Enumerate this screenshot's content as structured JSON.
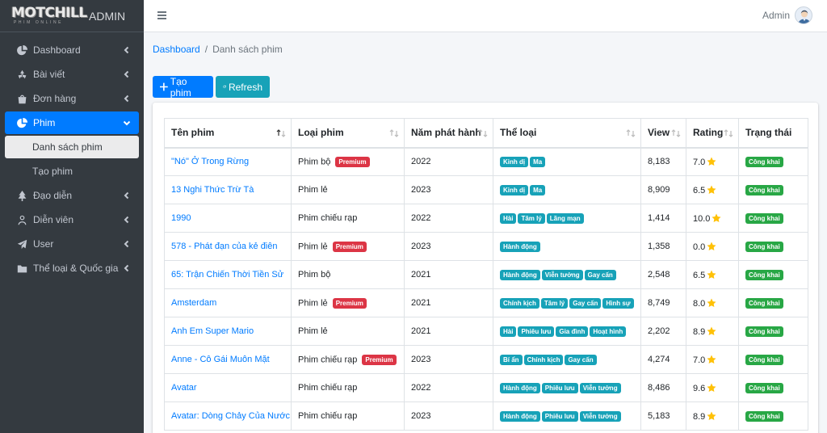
{
  "brand": {
    "logo_text": "MOTCHILL",
    "logo_sub": "PHIM ONLINE",
    "text": "ADMIN"
  },
  "header": {
    "user": "Admin"
  },
  "sidebar": {
    "items": [
      {
        "label": "Dashboard",
        "icon": "pie-chart-icon"
      },
      {
        "label": "Bài viết",
        "icon": "recycle-icon"
      },
      {
        "label": "Đơn hàng",
        "icon": "shopping-bag-icon"
      },
      {
        "label": "Phim",
        "icon": "pie-chart-icon",
        "active": true
      },
      {
        "label": "Đạo diễn",
        "icon": "tree-icon"
      },
      {
        "label": "Diễn viên",
        "icon": "user-icon"
      },
      {
        "label": "User",
        "icon": "paper-plane-icon"
      },
      {
        "label": "Thể loại & Quốc gia",
        "icon": "folder-icon"
      }
    ],
    "sub_items": [
      {
        "label": "Danh sách phim",
        "current": true
      },
      {
        "label": "Tạo phim"
      }
    ]
  },
  "breadcrumb": {
    "home": "Dashboard",
    "current": "Danh sách phim"
  },
  "buttons": {
    "create": "Tạo phim",
    "refresh": "Refresh"
  },
  "table": {
    "columns": [
      "Tên phim",
      "Loại phim",
      "Năm phát hành",
      "Thể loại",
      "View",
      "Rating",
      "Trạng thái"
    ],
    "rows": [
      {
        "title": "\"Nó\" Ở Trong Rừng",
        "type": "Phim bộ",
        "premium": "Premium",
        "year": "2022",
        "genres": [
          "Kinh dị",
          "Ma"
        ],
        "view": "8,183",
        "rating": "7.0",
        "status": "Công khai"
      },
      {
        "title": "13 Nghi Thức Trừ Tà",
        "type": "Phim lẻ",
        "premium": "",
        "year": "2023",
        "genres": [
          "Kinh dị",
          "Ma"
        ],
        "view": "8,909",
        "rating": "6.5",
        "status": "Công khai"
      },
      {
        "title": "1990",
        "type": "Phim chiếu rạp",
        "premium": "",
        "year": "2022",
        "genres": [
          "Hài",
          "Tâm lý",
          "Lãng mạn"
        ],
        "view": "1,414",
        "rating": "10.0",
        "status": "Công khai"
      },
      {
        "title": "578 - Phát đạn của kẻ điên",
        "type": "Phim lẻ",
        "premium": "Premium",
        "year": "2023",
        "genres": [
          "Hành động"
        ],
        "view": "1,358",
        "rating": "0.0",
        "status": "Công khai"
      },
      {
        "title": "65: Trận Chiến Thời Tiền Sử",
        "type": "Phim bộ",
        "premium": "",
        "year": "2021",
        "genres": [
          "Hành động",
          "Viễn tưởng",
          "Gay cấn"
        ],
        "view": "2,548",
        "rating": "6.5",
        "status": "Công khai"
      },
      {
        "title": "Amsterdam",
        "type": "Phim lẻ",
        "premium": "Premium",
        "year": "2021",
        "genres": [
          "Chính kịch",
          "Tâm lý",
          "Gay cấn",
          "Hình sự"
        ],
        "view": "8,749",
        "rating": "8.0",
        "status": "Công khai"
      },
      {
        "title": "Anh Em Super Mario",
        "type": "Phim lẻ",
        "premium": "",
        "year": "2021",
        "genres": [
          "Hài",
          "Phiêu lưu",
          "Gia đình",
          "Hoạt hình"
        ],
        "view": "2,202",
        "rating": "8.9",
        "status": "Công khai"
      },
      {
        "title": "Anne - Cô Gái Muôn Mặt",
        "type": "Phim chiếu rạp",
        "premium": "Premium",
        "year": "2023",
        "genres": [
          "Bí ẩn",
          "Chính kịch",
          "Gay cấn"
        ],
        "view": "4,274",
        "rating": "7.0",
        "status": "Công khai"
      },
      {
        "title": "Avatar",
        "type": "Phim chiếu rạp",
        "premium": "",
        "year": "2022",
        "genres": [
          "Hành động",
          "Phiêu lưu",
          "Viễn tưởng"
        ],
        "view": "8,486",
        "rating": "9.6",
        "status": "Công khai"
      },
      {
        "title": "Avatar: Dòng Chảy Của Nước",
        "type": "Phim chiếu rạp",
        "premium": "",
        "year": "2023",
        "genres": [
          "Hành động",
          "Phiêu lưu",
          "Viễn tưởng"
        ],
        "view": "5,183",
        "rating": "8.9",
        "status": "Công khai"
      }
    ]
  },
  "colors": {
    "primary": "#007bff",
    "info": "#17a2b8",
    "danger": "#dc3545",
    "success": "#28a745",
    "sidebar": "#343a40",
    "star": "#ffc107"
  }
}
